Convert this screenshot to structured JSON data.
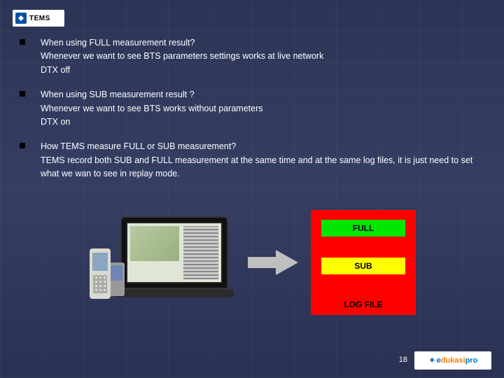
{
  "logo": {
    "text": "TEMS"
  },
  "bullets": [
    {
      "question": "When using FULL measurement result?",
      "answer": "Whenever we want to see BTS parameters settings works at live network",
      "note": "DTX off"
    },
    {
      "question": "When using SUB measurement result ?",
      "answer": "Whenever we want to see BTS works without parameters",
      "note": "DTX on"
    },
    {
      "question": "How TEMS measure FULL or SUB measurement?",
      "answer": "TEMS record both SUB and FULL measurement at the same time and at the same log files, it is just need to set what we wan to see in replay mode.",
      "note": ""
    }
  ],
  "diagram": {
    "full": "FULL",
    "sub": "SUB",
    "logfile": "LOG FILE"
  },
  "page_number": "18",
  "footer_brand": {
    "part1": "e",
    "part2": "dukasi",
    "part3": "pro"
  }
}
